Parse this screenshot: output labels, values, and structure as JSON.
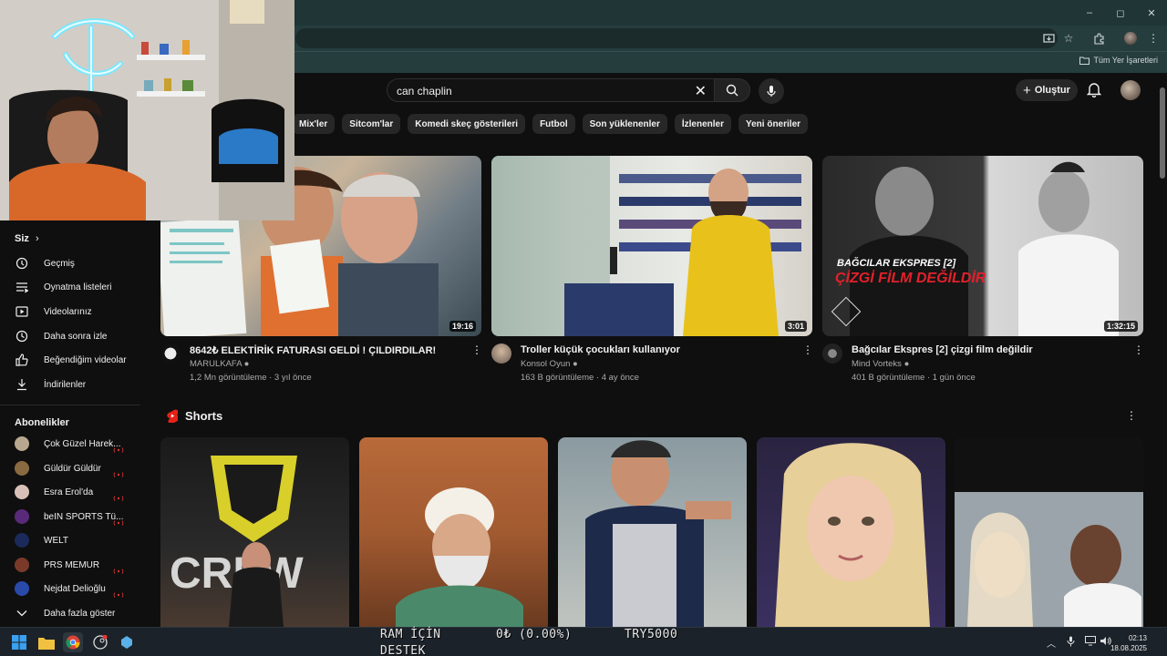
{
  "browser": {
    "window_controls": [
      "–",
      "◻",
      "✕"
    ],
    "bookmarks_all": "Tüm Yer İşaretleri"
  },
  "header": {
    "search_value": "can chaplin",
    "create_label": "Oluştur"
  },
  "chips": [
    "Mix'ler",
    "Sitcom'lar",
    "Komedi skeç gösterileri",
    "Futbol",
    "Son yüklenenler",
    "İzlenenler",
    "Yeni öneriler"
  ],
  "sidebar": {
    "you_heading": "Siz",
    "you_items": [
      {
        "label": "Geçmiş",
        "icon": "history-icon"
      },
      {
        "label": "Oynatma listeleri",
        "icon": "playlists-icon"
      },
      {
        "label": "Videolarınız",
        "icon": "your-videos-icon"
      },
      {
        "label": "Daha sonra izle",
        "icon": "watch-later-icon"
      },
      {
        "label": "Beğendiğim videolar",
        "icon": "liked-icon"
      },
      {
        "label": "İndirilenler",
        "icon": "download-icon"
      }
    ],
    "subs_heading": "Abonelikler",
    "subscriptions": [
      {
        "label": "Çok Güzel Harek...",
        "live": true,
        "color": "#b8a890"
      },
      {
        "label": "Güldür Güldür",
        "live": true,
        "color": "#8a6a40"
      },
      {
        "label": "Esra Erol'da",
        "live": true,
        "color": "#d8c0b8"
      },
      {
        "label": "beIN SPORTS Tü...",
        "live": true,
        "color": "#5a2a7a"
      },
      {
        "label": "WELT",
        "live": false,
        "color": "#1a2a5a"
      },
      {
        "label": "PRS MEMUR",
        "live": true,
        "color": "#7a3a2a"
      },
      {
        "label": "Nejdat Delioğlu",
        "live": true,
        "color": "#2a4aaa"
      }
    ],
    "show_more": "Daha fazla göster"
  },
  "videos": [
    {
      "title": "8642₺ ELEKTİRİK FATURASI GELDİ ! ÇILDIRDILAR!",
      "channel": "MARULKAFA",
      "meta": "1,2 Mn görüntüleme · 3 yıl önce",
      "duration": "19:16"
    },
    {
      "title": "Troller küçük çocukları kullanıyor",
      "channel": "Konsol Oyun",
      "meta": "163 B görüntüleme · 4 ay önce",
      "duration": "3:01"
    },
    {
      "title": "Bağcılar Ekspres [2] çizgi film değildir",
      "channel": "Mind Vorteks",
      "meta": "401 B görüntüleme · 1 gün önce",
      "duration": "1:32:15"
    }
  ],
  "thumb3_text": {
    "line1": "BAĞCILAR EKSPRES [2]",
    "line2": "ÇİZGİ FİLM DEĞİLDİR"
  },
  "shorts": {
    "heading": "Shorts"
  },
  "overlay": {
    "ram_label": "RAM İÇİN",
    "support_label": "DESTEK",
    "amount": "0₺ (0.00%)",
    "goal": "TRY5000"
  },
  "taskbar": {
    "time": "02:13",
    "date": "18.08.2025"
  }
}
